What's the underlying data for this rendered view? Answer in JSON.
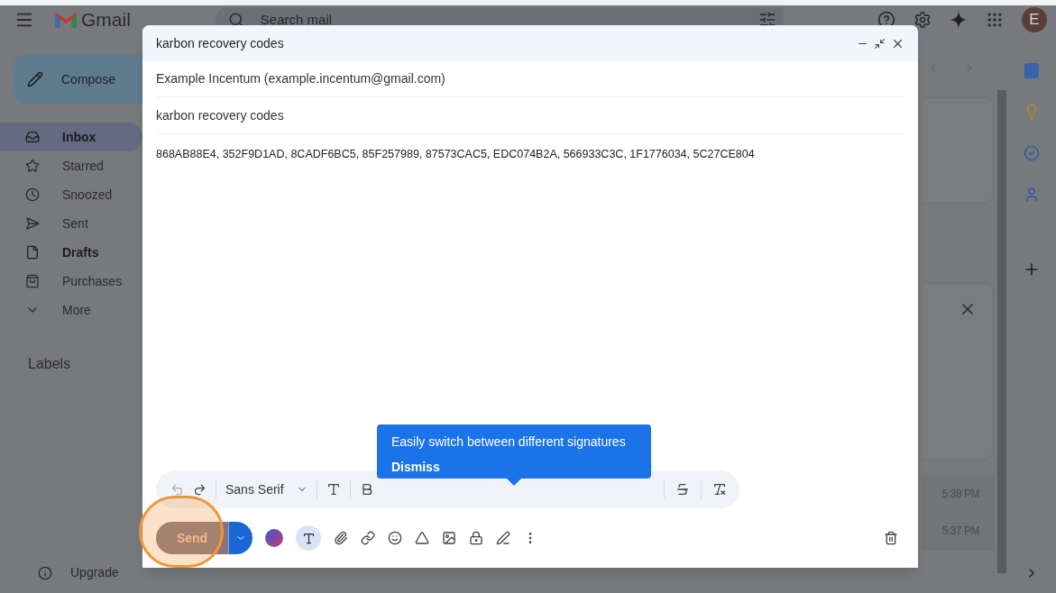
{
  "header": {
    "app_name": "Gmail",
    "search": {
      "placeholder": "Search mail"
    },
    "avatar_letter": "E"
  },
  "sidebar": {
    "compose": "Compose",
    "items": [
      {
        "label": "Inbox",
        "selected": true,
        "bold": true
      },
      {
        "label": "Starred",
        "selected": false,
        "bold": false
      },
      {
        "label": "Snoozed",
        "selected": false,
        "bold": false
      },
      {
        "label": "Sent",
        "selected": false,
        "bold": false
      },
      {
        "label": "Drafts",
        "selected": false,
        "bold": true
      },
      {
        "label": "Purchases",
        "selected": false,
        "bold": false
      },
      {
        "label": "More",
        "selected": false,
        "bold": false
      }
    ],
    "labels_heading": "Labels",
    "upgrade": "Upgrade"
  },
  "background_list": {
    "times": [
      "5:38 PM",
      "5:37 PM"
    ]
  },
  "compose": {
    "title": "karbon recovery codes",
    "from": "Example Incentum (example.incentum@gmail.com)",
    "subject": "karbon recovery codes",
    "body": "868AB88E4, 352F9D1AD, 8CADF6BC5, 85F257989, 87573CAC5, EDC074B2A, 566933C3C, 1F1776034, 5C27CE804",
    "font": "Sans Serif",
    "send": "Send",
    "tooltip": {
      "text": "Easily switch between different signatures",
      "dismiss": "Dismiss"
    }
  }
}
